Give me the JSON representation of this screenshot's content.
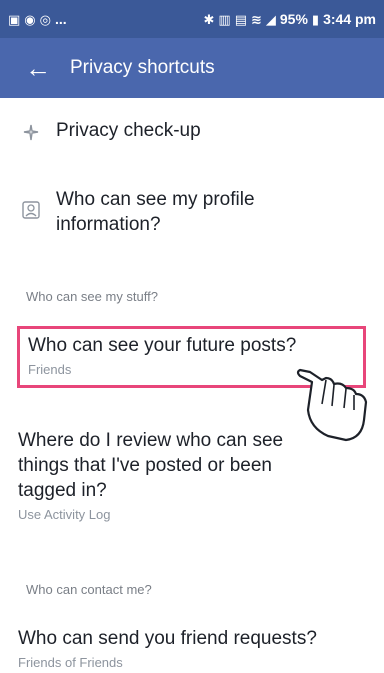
{
  "statusbar": {
    "left_icons": [
      "gallery-icon",
      "chat-icon",
      "instagram-icon",
      "more-dots"
    ],
    "dots": "...",
    "battery": "95%",
    "time": "3:44 pm"
  },
  "appbar": {
    "title": "Privacy shortcuts"
  },
  "top_items": [
    {
      "icon": "sparkle-icon",
      "label": "Privacy check-up"
    },
    {
      "icon": "profile-card-icon",
      "label": "Who can see my profile information?"
    }
  ],
  "sections": [
    {
      "heading": "Who can see my stuff?",
      "rows": [
        {
          "title": "Who can see your future posts?",
          "subtitle": "Friends"
        },
        {
          "title": "Where do I review who can see things that I've posted or been tagged in?",
          "subtitle": "Use Activity Log"
        }
      ]
    },
    {
      "heading": "Who can contact me?",
      "rows": [
        {
          "title": "Who can send you friend requests?",
          "subtitle": "Friends of Friends"
        }
      ]
    }
  ],
  "colors": {
    "statusbar": "#3b5998",
    "appbar": "#4a67ad",
    "highlight": "#e8467a"
  }
}
